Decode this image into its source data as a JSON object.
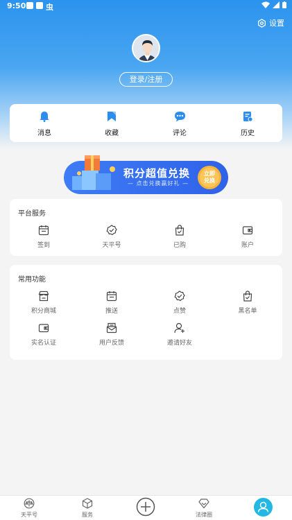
{
  "status": {
    "time": "9:50",
    "bug_glyph": "虫"
  },
  "header": {
    "settings_label": "设置",
    "login_label": "登录/注册"
  },
  "quick_actions": [
    {
      "label": "消息",
      "icon": "bell-icon"
    },
    {
      "label": "收藏",
      "icon": "bookmark-icon"
    },
    {
      "label": "评论",
      "icon": "comment-icon"
    },
    {
      "label": "历史",
      "icon": "history-icon"
    }
  ],
  "banner": {
    "title": "积分超值兑换",
    "subtitle": "— 点击兑换赢好礼 —",
    "button_line1": "立即",
    "button_line2": "兑换"
  },
  "platform": {
    "title": "平台服务",
    "items": [
      {
        "label": "签到",
        "icon": "calendar-icon"
      },
      {
        "label": "天平号",
        "icon": "verified-icon"
      },
      {
        "label": "已购",
        "icon": "shopping-bag-icon"
      },
      {
        "label": "账户",
        "icon": "wallet-icon"
      }
    ]
  },
  "common": {
    "title": "常用功能",
    "items": [
      {
        "label": "积分商城",
        "icon": "store-icon"
      },
      {
        "label": "推送",
        "icon": "calendar-icon"
      },
      {
        "label": "点赞",
        "icon": "verified-icon"
      },
      {
        "label": "黑名单",
        "icon": "shopping-bag-icon"
      },
      {
        "label": "实名认证",
        "icon": "wallet-icon"
      },
      {
        "label": "用户反馈",
        "icon": "mail-icon"
      },
      {
        "label": "邀请好友",
        "icon": "add-user-icon"
      }
    ]
  },
  "tabs": [
    {
      "label": "天平号",
      "icon": "balance-icon"
    },
    {
      "label": "服务",
      "icon": "cube-icon"
    },
    {
      "label": "",
      "icon": "plus-circle-icon"
    },
    {
      "label": "法律圈",
      "icon": "diamond-icon"
    },
    {
      "label": "",
      "icon": "user-active-icon"
    }
  ],
  "colors": {
    "brand_blue": "#2b93ee",
    "accent_orange": "#f7b23b"
  }
}
